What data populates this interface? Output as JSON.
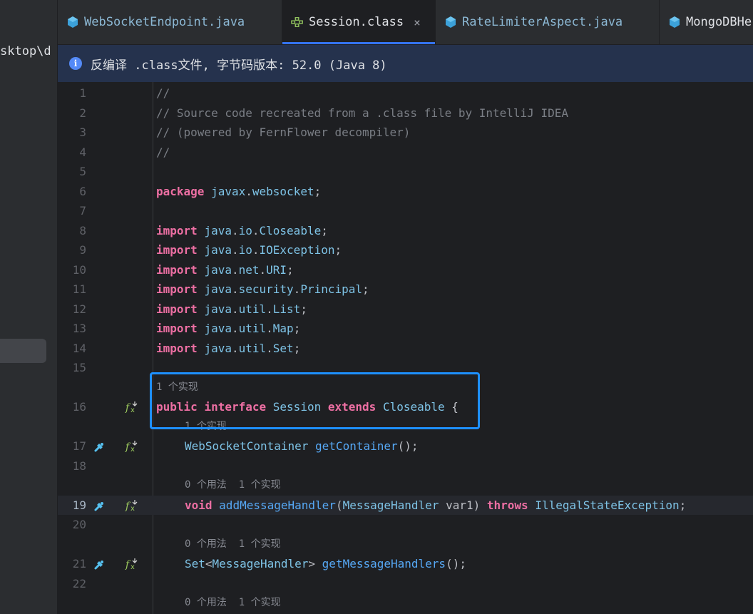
{
  "project_panel": {
    "path_fragment": "sktop\\d"
  },
  "tabs": [
    {
      "label": "WebSocketEndpoint.java",
      "icon": "java-class-icon"
    },
    {
      "label": "Session.class",
      "icon": "interface-class-icon",
      "active": true,
      "close": "×"
    },
    {
      "label": "RateLimiterAspect.java",
      "icon": "java-class-icon"
    },
    {
      "label": "MongoDBHe",
      "icon": "java-class-icon"
    }
  ],
  "banner": {
    "info": "i",
    "text": "反编译 .class文件, 字节码版本: 52.0 (Java 8)"
  },
  "editor": {
    "current_line": 19,
    "lines": [
      {
        "n": "1",
        "t": "//"
      },
      {
        "n": "2",
        "t": "// Source code recreated from a .class file by IntelliJ IDEA"
      },
      {
        "n": "3",
        "t": "// (powered by FernFlower decompiler)"
      },
      {
        "n": "4",
        "t": "//"
      },
      {
        "n": "5",
        "t": ""
      },
      {
        "n": "6",
        "t": "package javax.websocket;"
      },
      {
        "n": "7",
        "t": ""
      },
      {
        "n": "8",
        "t": "import java.io.Closeable;"
      },
      {
        "n": "9",
        "t": "import java.io.IOException;"
      },
      {
        "n": "10",
        "t": "import java.net.URI;"
      },
      {
        "n": "11",
        "t": "import java.security.Principal;"
      },
      {
        "n": "12",
        "t": "import java.util.List;"
      },
      {
        "n": "13",
        "t": "import java.util.Map;"
      },
      {
        "n": "14",
        "t": "import java.util.Set;"
      },
      {
        "n": "15",
        "t": ""
      },
      {
        "hint": "1 个实现"
      },
      {
        "n": "16",
        "t": "public interface Session extends Closeable {"
      },
      {
        "hint": "1 个实现"
      },
      {
        "n": "17",
        "t": "WebSocketContainer getContainer();"
      },
      {
        "n": "18",
        "t": ""
      },
      {
        "hint": "0 个用法  1 个实现"
      },
      {
        "n": "19",
        "t": "void addMessageHandler(MessageHandler var1) throws IllegalStateException;"
      },
      {
        "n": "20",
        "t": ""
      },
      {
        "hint": "0 个用法  1 个实现"
      },
      {
        "n": "21",
        "t": "Set<MessageHandler> getMessageHandlers();"
      },
      {
        "n": "22",
        "t": ""
      },
      {
        "hint": "0 个用法  1 个实现"
      }
    ]
  },
  "colors": {
    "keyword": "#ed6fa3",
    "type": "#7ec3e6",
    "comment": "#7a7e85",
    "highlight": "#1e90ff",
    "banner": "#25324d"
  }
}
